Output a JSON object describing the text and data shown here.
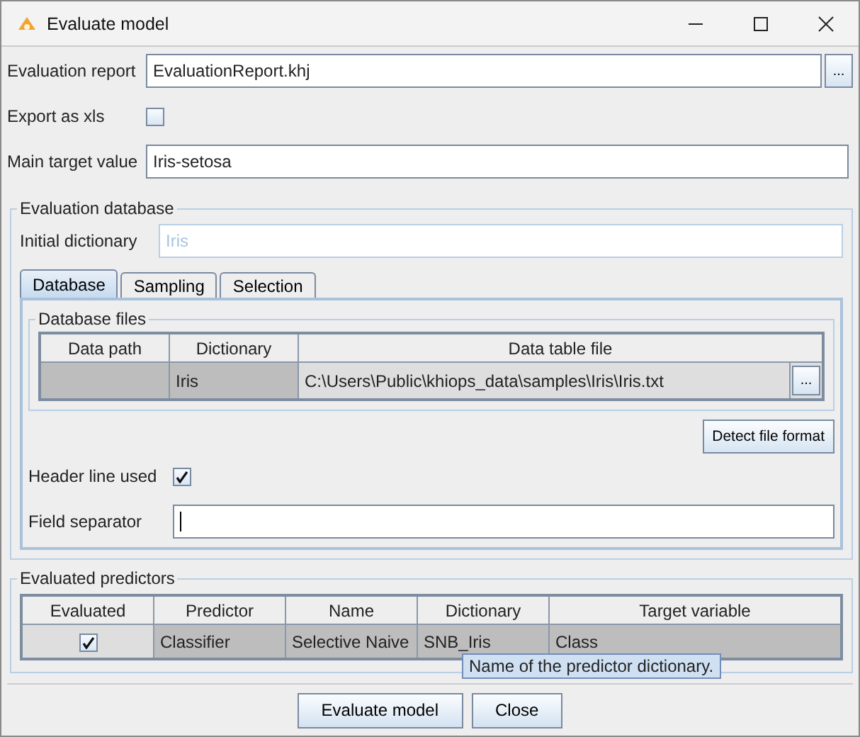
{
  "window": {
    "title": "Evaluate model"
  },
  "evaluation_report": {
    "label": "Evaluation report",
    "value": "EvaluationReport.khj",
    "browse": "..."
  },
  "export_as_xls": {
    "label": "Export as xls",
    "checked": false
  },
  "main_target_value": {
    "label": "Main target value",
    "value": "Iris-setosa"
  },
  "evaluation_database": {
    "title": "Evaluation database",
    "initial_dictionary": {
      "label": "Initial dictionary",
      "value": "Iris",
      "disabled": true
    },
    "tabs": [
      {
        "label": "Database",
        "selected": true
      },
      {
        "label": "Sampling",
        "selected": false
      },
      {
        "label": "Selection",
        "selected": false
      }
    ],
    "database_files": {
      "title": "Database files",
      "columns": [
        "Data path",
        "Dictionary",
        "Data table file"
      ],
      "rows": [
        {
          "dictionary": "Iris",
          "data_table_file": "C:\\Users\\Public\\khiops_data\\samples\\Iris\\Iris.txt",
          "browse": "..."
        }
      ]
    },
    "detect_button": "Detect file format",
    "header_line_used": {
      "label": "Header line used",
      "checked": true
    },
    "field_separator": {
      "label": "Field separator"
    }
  },
  "evaluated_predictors": {
    "title": "Evaluated predictors",
    "columns": [
      "Evaluated",
      "Predictor",
      "Name",
      "Dictionary",
      "Target variable"
    ],
    "rows": [
      {
        "evaluated": true,
        "predictor": "Classifier",
        "name": "Selective Naive",
        "dictionary": "SNB_Iris",
        "target_variable": "Class"
      }
    ],
    "tooltip": "Name of the predictor dictionary."
  },
  "buttons": [
    "Evaluate model",
    "Close"
  ]
}
